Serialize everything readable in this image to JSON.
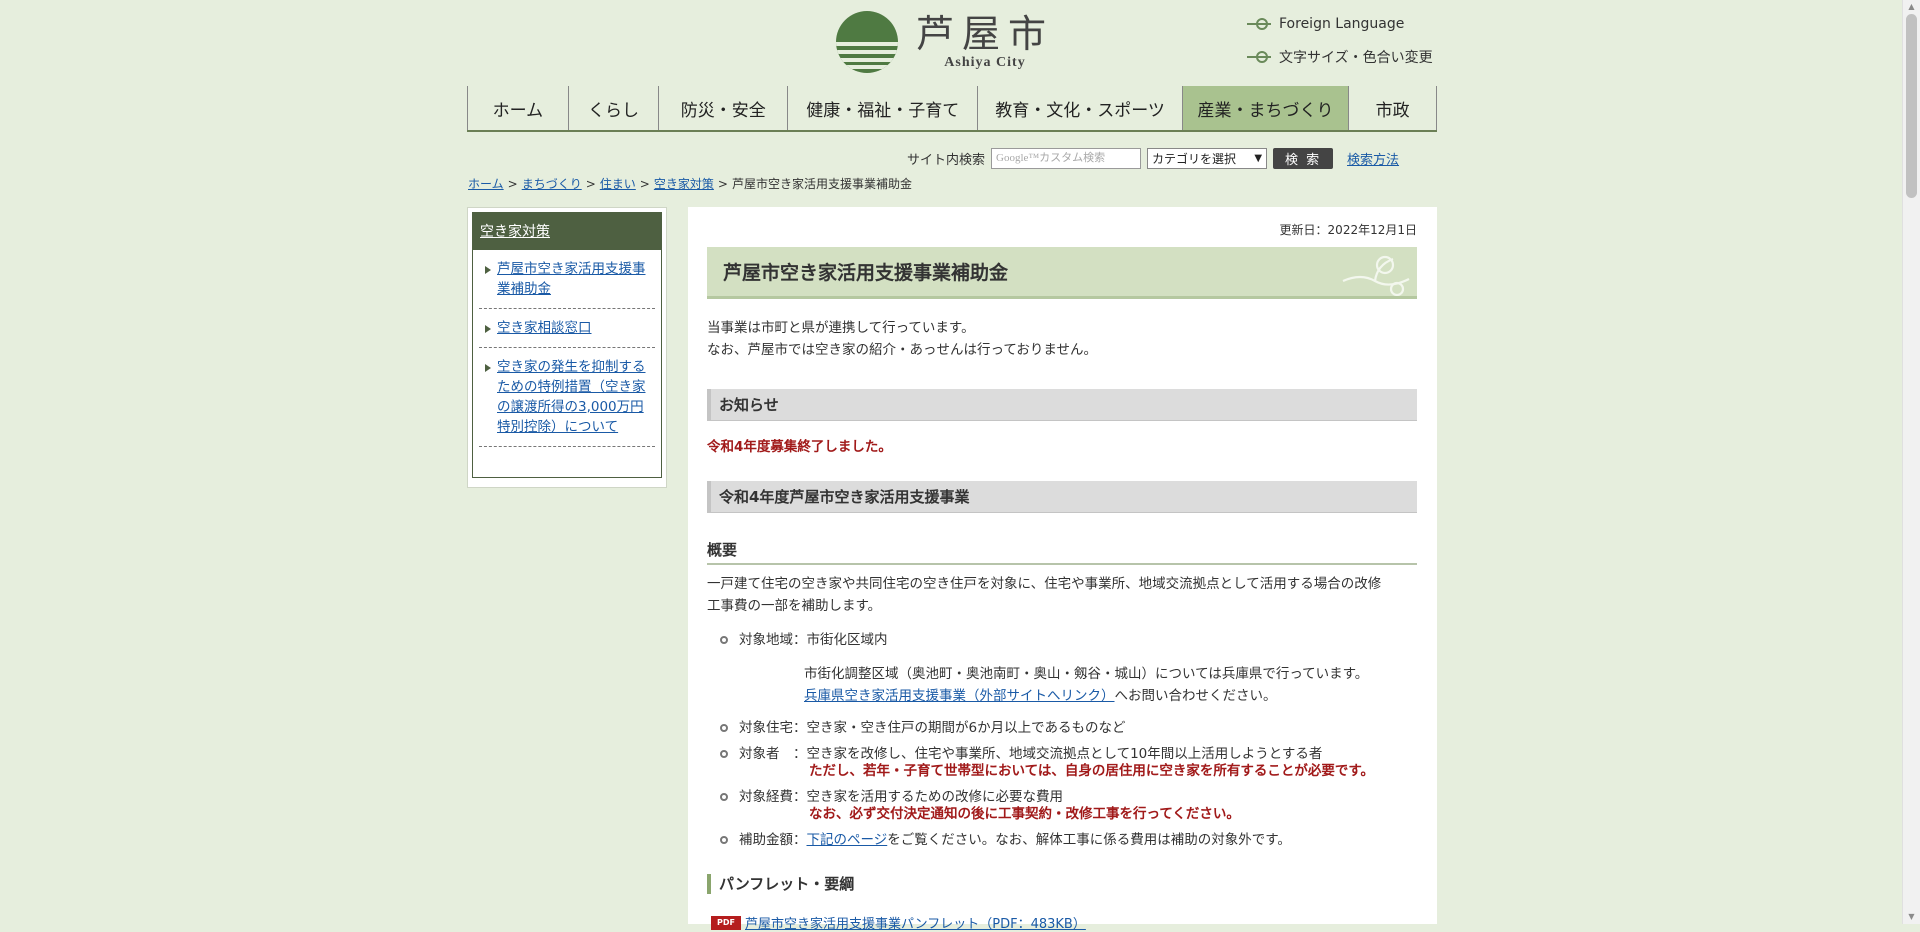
{
  "header": {
    "logo_jp": "芦屋市",
    "logo_en": "Ashiya City",
    "foreign_language": "Foreign Language",
    "text_size": "文字サイズ・色合い変更"
  },
  "nav": [
    {
      "label": "ホーム"
    },
    {
      "label": "くらし"
    },
    {
      "label": "防災・安全"
    },
    {
      "label": "健康・福祉・子育て"
    },
    {
      "label": "教育・文化・スポーツ"
    },
    {
      "label": "産業・まちづくり",
      "active": true
    },
    {
      "label": "市政"
    }
  ],
  "search": {
    "label": "サイト内検索",
    "placeholder": "Google™カスタム検索",
    "category": "カテゴリを選択",
    "button": "検 索",
    "help": "検索方法"
  },
  "breadcrumb": [
    "ホーム",
    "まちづくり",
    "住まい",
    "空き家対策",
    "芦屋市空き家活用支援事業補助金"
  ],
  "sidebar": {
    "title": "空き家対策",
    "items": [
      "芦屋市空き家活用支援事業補助金",
      "空き家相談窓口",
      "空き家の発生を抑制するための特例措置（空き家の譲渡所得の3,000万円特別控除）について"
    ]
  },
  "main": {
    "updated": "更新日：2022年12月1日",
    "title": "芦屋市空き家活用支援事業補助金",
    "intro1": "当事業は市町と県が連携して行っています。",
    "intro2": "なお、芦屋市では空き家の紹介・あっせんは行っておりません。",
    "notice_heading": "お知らせ",
    "notice_text": "令和4年度募集終了しました。",
    "section_heading": "令和4年度芦屋市空き家活用支援事業",
    "overview_heading": "概要",
    "overview_text1": "一戸建て住宅の空き家や共同住宅の空き住戸を対象に、住宅や事業所、地域交流拠点として活用する場合の改修",
    "overview_text2": "工事費の一部を補助します。",
    "area_label": "対象地域：市街化区域内",
    "area_note": "市街化調整区域（奥池町・奥池南町・奥山・剱谷・城山）については兵庫県で行っています。",
    "area_link": "兵庫県空き家活用支援事業（外部サイトへリンク）",
    "area_link_suffix": "へお問い合わせください。",
    "housing": "対象住宅：空き家・空き住戸の期間が6か月以上であるものなど",
    "person": "対象者　：空き家を改修し、住宅や事業所、地域交流拠点として10年間以上活用しようとする者",
    "person_note": "ただし、若年・子育て世帯型においては、自身の居住用に空き家を所有することが必要です。",
    "cost": "対象経費：空き家を活用するための改修に必要な費用",
    "cost_note": "なお、必ず交付決定通知の後に工事契約・改修工事を行ってください。",
    "amount_prefix": "補助金額：",
    "amount_link": "下記のページ",
    "amount_suffix": "をご覧ください。なお、解体工事に係る費用は補助の対象外です。",
    "pamphlet_heading": "パンフレット・要綱",
    "pdf_badge": "PDF",
    "pamphlet_link": "芦屋市空き家活用支援事業パンフレット（PDF：483KB）"
  },
  "colors": {
    "background": "#e6eedd",
    "brand_green": "#4f7a42",
    "accent_red": "#a11a1a",
    "link": "#1a5aa6"
  }
}
